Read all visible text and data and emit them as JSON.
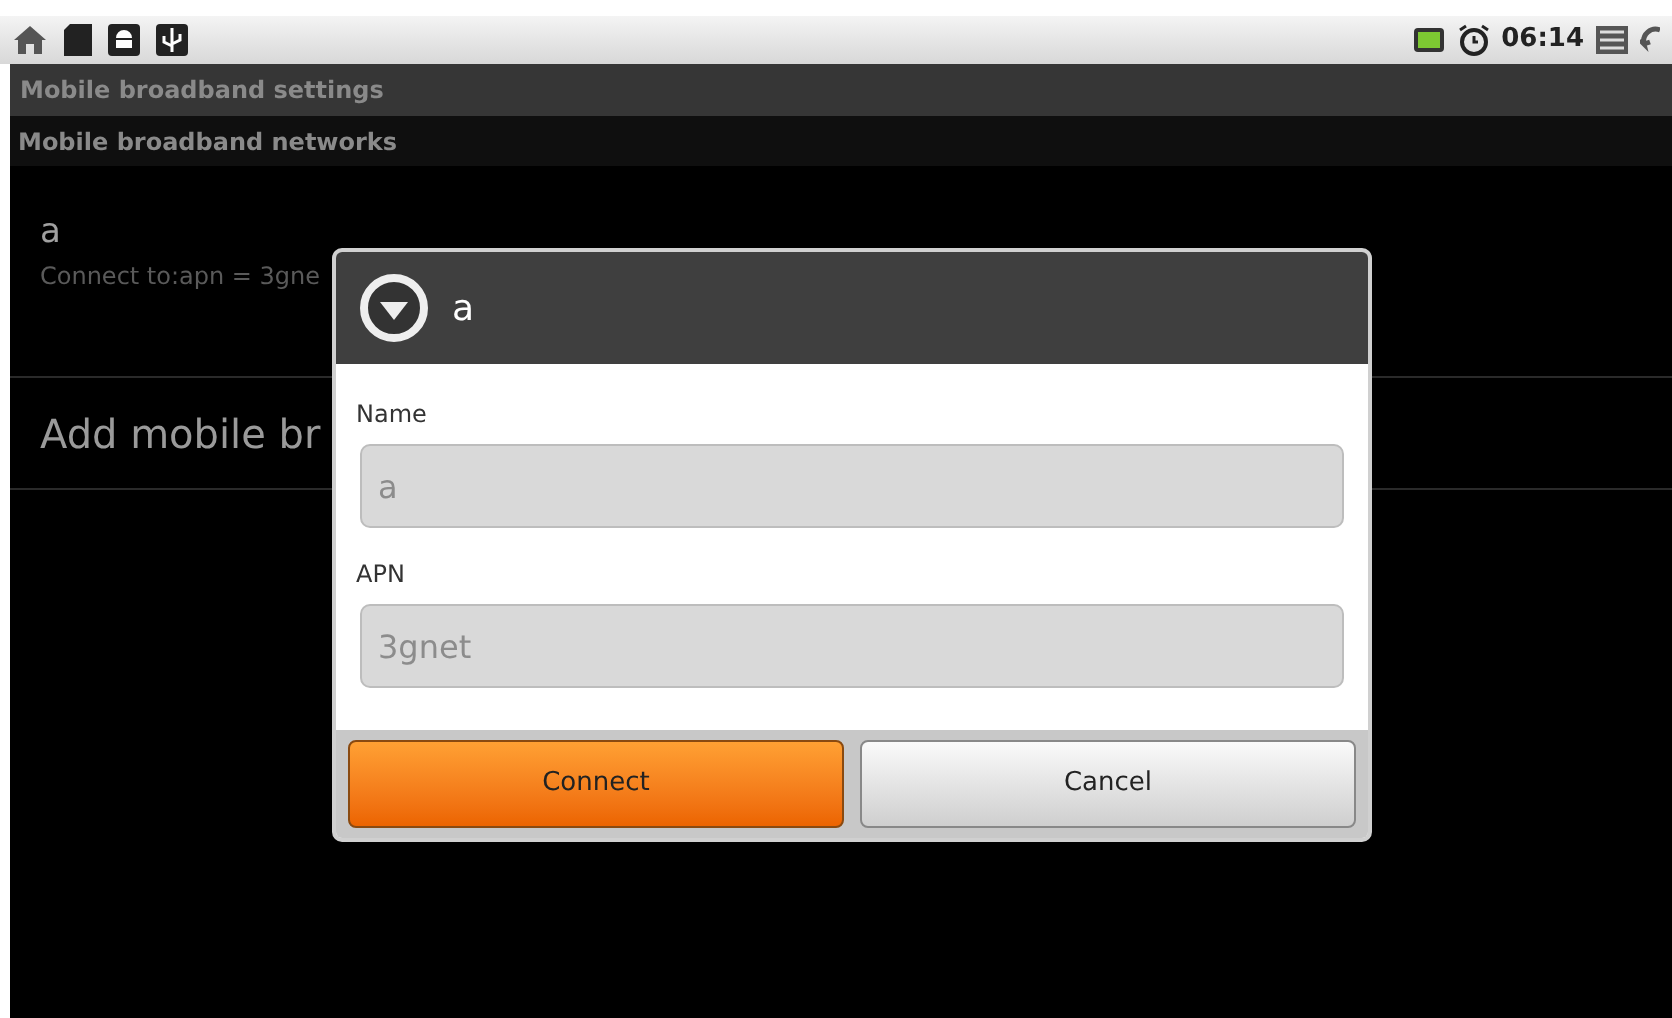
{
  "status_bar": {
    "time": "06:14"
  },
  "title_bar": {
    "title": "Mobile broadband settings"
  },
  "section_header": {
    "title": "Mobile broadband networks"
  },
  "list": [
    {
      "kind": "network",
      "title": "a",
      "subtitle": "Connect to:apn = 3gne"
    },
    {
      "kind": "action",
      "title": "Add mobile br"
    }
  ],
  "dialog": {
    "title": "a",
    "fields": [
      {
        "label": "Name",
        "value": "a",
        "disabled": true
      },
      {
        "label": "APN",
        "value": "3gnet",
        "disabled": true
      }
    ],
    "buttons": [
      {
        "label": "Connect",
        "selected": true
      },
      {
        "label": "Cancel",
        "selected": false
      }
    ]
  }
}
